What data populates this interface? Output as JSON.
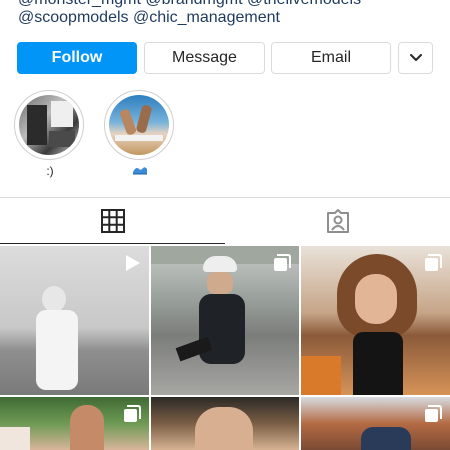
{
  "bio": {
    "line1": "@monster_mgmt @brandmgmt @thelivemodels",
    "line2": "@scoopmodels @chic_management"
  },
  "actions": {
    "follow": "Follow",
    "message": "Message",
    "email": "Email"
  },
  "highlights": [
    {
      "label": ":)"
    },
    {
      "label": "",
      "icon": "wave-emoji-icon"
    }
  ],
  "tabs": [
    {
      "name": "posts-grid",
      "icon": "grid-icon",
      "active": true
    },
    {
      "name": "tagged",
      "icon": "tagged-person-icon",
      "active": false
    }
  ],
  "posts": [
    {
      "badge": "video-icon"
    },
    {
      "badge": "carousel-icon"
    },
    {
      "badge": "carousel-icon"
    },
    {
      "badge": "carousel-icon"
    },
    {
      "badge": "none"
    },
    {
      "badge": "carousel-icon"
    }
  ],
  "colors": {
    "accent": "#0095f6",
    "link": "#1e3a5f",
    "border": "#dbdbdb"
  }
}
